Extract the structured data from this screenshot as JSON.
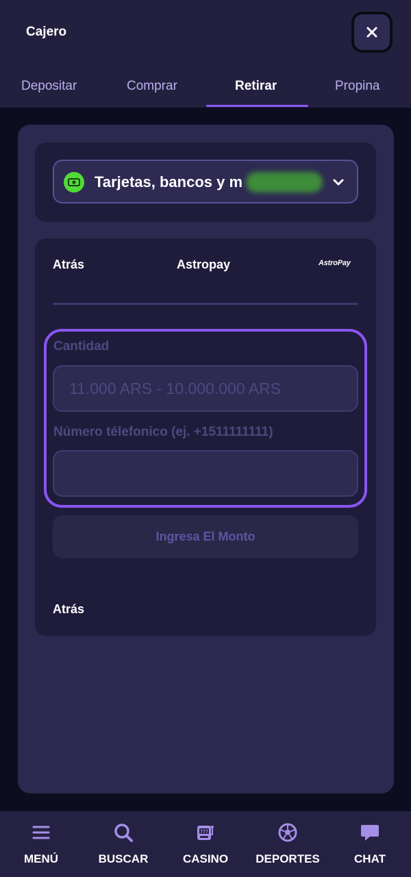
{
  "header": {
    "title": "Cajero",
    "close_icon": "close-icon"
  },
  "tabs": [
    {
      "label": "Depositar",
      "active": false
    },
    {
      "label": "Comprar",
      "active": false
    },
    {
      "label": "Retirar",
      "active": true
    },
    {
      "label": "Propina",
      "active": false
    }
  ],
  "method_selector": {
    "icon": "cash-icon",
    "label": "Tarjetas, bancos y m",
    "chevron_icon": "chevron-down-icon"
  },
  "form": {
    "back_label": "Atrás",
    "method_title": "Astropay",
    "logo_text": "AstroPay",
    "amount_label": "Cantidad",
    "amount_value": "",
    "amount_placeholder": "11.000 ARS - 10.000.000 ARS",
    "phone_label": "Número télefonico (ej. +1511111111)",
    "phone_value": "",
    "phone_placeholder": "",
    "submit_label": "Ingresa El Monto",
    "back_bottom_label": "Atrás"
  },
  "bottom_nav": [
    {
      "label": "MENÚ",
      "icon": "menu-icon"
    },
    {
      "label": "BUSCAR",
      "icon": "search-icon"
    },
    {
      "label": "CASINO",
      "icon": "slot-machine-icon"
    },
    {
      "label": "DEPORTES",
      "icon": "soccer-ball-icon"
    },
    {
      "label": "CHAT",
      "icon": "chat-bubble-icon"
    }
  ],
  "colors": {
    "accent": "#8b5cf6",
    "header_bg": "#23203f",
    "panel_bg": "#2d2850",
    "card_bg": "#1f1c3b",
    "cash_icon_green": "#4fdc35",
    "nav_icon": "#a58ee6"
  }
}
